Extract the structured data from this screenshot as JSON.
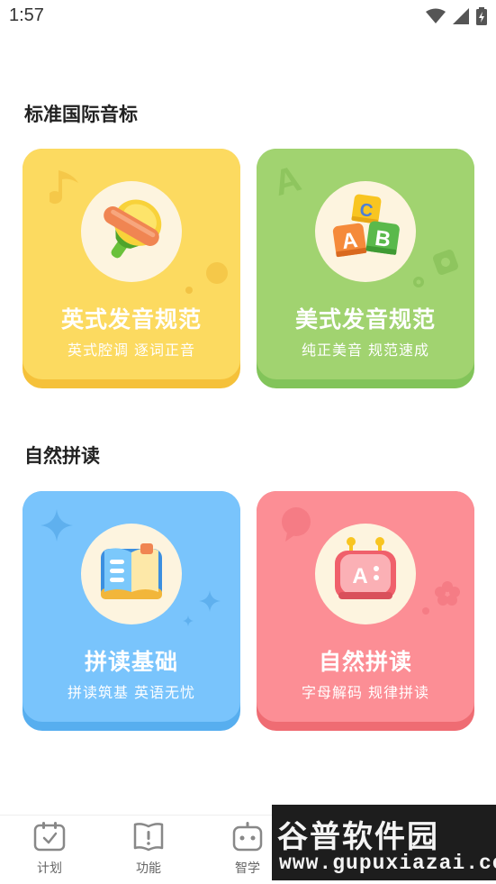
{
  "status_bar": {
    "time": "1:57"
  },
  "sections": [
    {
      "title": "标准国际音标",
      "cards": [
        {
          "title": "英式发音规范",
          "subtitle": "英式腔调 逐词正音",
          "icon": "horn-icon",
          "color": "#fcda60"
        },
        {
          "title": "美式发音规范",
          "subtitle": "纯正美音 规范速成",
          "icon": "abc-blocks-icon",
          "color": "#a1d370"
        }
      ]
    },
    {
      "title": "自然拼读",
      "cards": [
        {
          "title": "拼读基础",
          "subtitle": "拼读筑基 英语无忧",
          "icon": "book-icon",
          "color": "#79c4fc"
        },
        {
          "title": "自然拼读",
          "subtitle": "字母解码 规律拼读",
          "icon": "robot-letter-icon",
          "color": "#fc8e95"
        }
      ]
    }
  ],
  "bottom_nav": {
    "items": [
      {
        "label": "计划",
        "icon": "calendar-icon"
      },
      {
        "label": "功能",
        "icon": "book-info-icon"
      },
      {
        "label": "智学",
        "icon": "robot-icon"
      }
    ]
  },
  "watermark": {
    "cn": "谷普软件园",
    "en": "www.gupuxiazai.com"
  }
}
